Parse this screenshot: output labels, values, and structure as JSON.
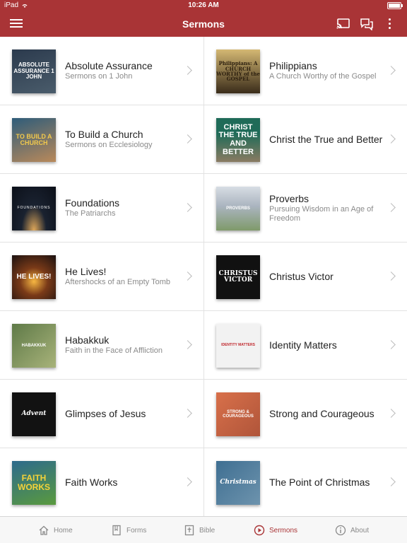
{
  "status": {
    "carrier": "iPad",
    "time": "10:26 AM"
  },
  "header": {
    "title": "Sermons"
  },
  "sermons": [
    {
      "title": "Absolute Assurance",
      "subtitle": "Sermons on 1 John",
      "art": "ABSOLUTE ASSURANCE 1 JOHN"
    },
    {
      "title": "Philippians",
      "subtitle": "A Church Worthy of the Gospel",
      "art": "Philippians: A CHURCH WORTHY of the GOSPEL"
    },
    {
      "title": "To Build a Church",
      "subtitle": "Sermons on Ecclesiology",
      "art": "TO BUILD A CHURCH"
    },
    {
      "title": "Christ the True and Better",
      "subtitle": "",
      "art": "CHRIST THE TRUE AND BETTER"
    },
    {
      "title": "Foundations",
      "subtitle": "The Patriarchs",
      "art": "FOUNDATIONS"
    },
    {
      "title": "Proverbs",
      "subtitle": "Pursuing Wisdom in an Age of Freedom",
      "art": "PROVERBS"
    },
    {
      "title": "He Lives!",
      "subtitle": "Aftershocks of an Empty Tomb",
      "art": "HE LIVES!"
    },
    {
      "title": "Christus Victor",
      "subtitle": "",
      "art": "CHRISTUS VICTOR"
    },
    {
      "title": "Habakkuk",
      "subtitle": "Faith in the Face of Affliction",
      "art": "HABAKKUK"
    },
    {
      "title": "Identity Matters",
      "subtitle": "",
      "art": "IDENTITY MATTERS"
    },
    {
      "title": "Glimpses of Jesus",
      "subtitle": "",
      "art": "Advent"
    },
    {
      "title": "Strong and Courageous",
      "subtitle": "",
      "art": "STRONG & COURAGEOUS"
    },
    {
      "title": "Faith Works",
      "subtitle": "",
      "art": "FAITH WORKS"
    },
    {
      "title": "The Point of Christmas",
      "subtitle": "",
      "art": "Christmas"
    }
  ],
  "tabs": [
    {
      "label": "Home",
      "icon": "home-icon"
    },
    {
      "label": "Forms",
      "icon": "forms-icon"
    },
    {
      "label": "Bible",
      "icon": "bible-icon"
    },
    {
      "label": "Sermons",
      "icon": "play-circle-icon",
      "active": true
    },
    {
      "label": "About",
      "icon": "info-icon"
    }
  ],
  "colors": {
    "brand": "#a93436",
    "divider": "#e2e2e2"
  }
}
